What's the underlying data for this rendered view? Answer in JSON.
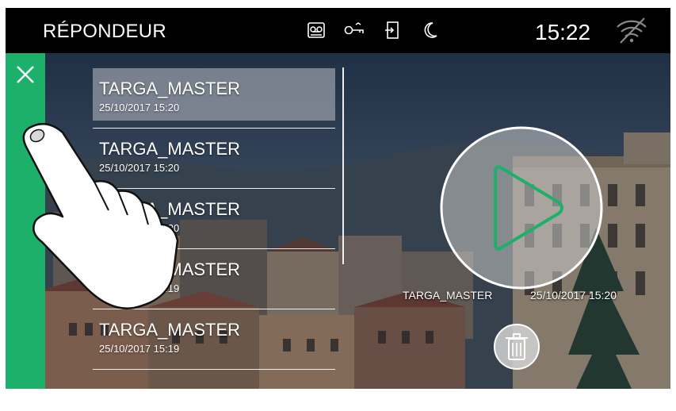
{
  "header": {
    "title": "RÉPONDEUR",
    "time": "15:22",
    "icons": [
      "voicemail-icon",
      "key-icon",
      "door-exit-icon",
      "moon-icon",
      "wifi-off-icon"
    ]
  },
  "sidebar": {
    "close_icon": "close-icon"
  },
  "messages": [
    {
      "name": "TARGA_MASTER",
      "date": "25/10/2017 15:20",
      "selected": true
    },
    {
      "name": "TARGA_MASTER",
      "date": "25/10/2017 15:20",
      "selected": false
    },
    {
      "name": "TARGA_MASTER",
      "date": "25/10/2017 15:20",
      "selected": false
    },
    {
      "name": "TARGA_MASTER",
      "date": "25/10/2017 15:19",
      "selected": false
    },
    {
      "name": "TARGA_MASTER",
      "date": "25/10/2017 15:19",
      "selected": false
    }
  ],
  "player": {
    "name": "TARGA_MASTER",
    "date": "25/10/2017 15:20"
  },
  "colors": {
    "accent": "#1db06b",
    "topbar": "#000000"
  }
}
